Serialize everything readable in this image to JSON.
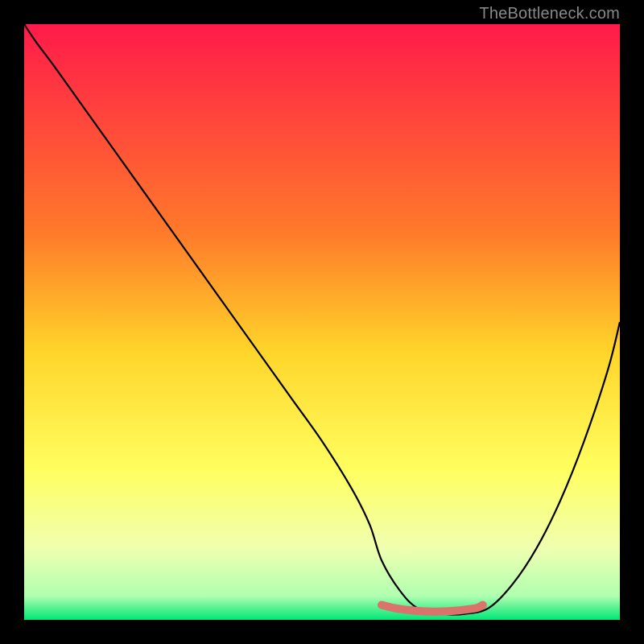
{
  "watermark": "TheBottleneck.com",
  "chart_data": {
    "type": "line",
    "title": "",
    "xlabel": "",
    "ylabel": "",
    "xlim": [
      0,
      100
    ],
    "ylim": [
      0,
      100
    ],
    "gradient_stops": [
      {
        "offset": 0,
        "color": "#ff1a4a"
      },
      {
        "offset": 35,
        "color": "#ff7a2a"
      },
      {
        "offset": 55,
        "color": "#ffd52a"
      },
      {
        "offset": 75,
        "color": "#ffff60"
      },
      {
        "offset": 88,
        "color": "#f0ffb0"
      },
      {
        "offset": 96,
        "color": "#b0ffb0"
      },
      {
        "offset": 100,
        "color": "#00e676"
      }
    ],
    "series": [
      {
        "name": "bottleneck-curve",
        "color": "#000000",
        "x": [
          0,
          2,
          5,
          10,
          15,
          20,
          25,
          30,
          35,
          40,
          45,
          50,
          55,
          58,
          60,
          63,
          66,
          70,
          74,
          78,
          82,
          86,
          90,
          94,
          98,
          100
        ],
        "y": [
          100,
          97,
          93,
          86,
          79,
          72,
          65,
          58,
          51,
          44,
          37,
          30,
          22,
          16,
          10,
          5,
          2,
          1,
          1,
          2,
          6,
          12,
          20,
          30,
          42,
          50
        ]
      },
      {
        "name": "optimal-zone-marker",
        "color": "#d9736b",
        "x": [
          60,
          62,
          64,
          66,
          68,
          70,
          72,
          74,
          76,
          77
        ],
        "y": [
          2.5,
          2.0,
          1.7,
          1.5,
          1.4,
          1.4,
          1.5,
          1.7,
          2.0,
          2.5
        ]
      }
    ]
  }
}
